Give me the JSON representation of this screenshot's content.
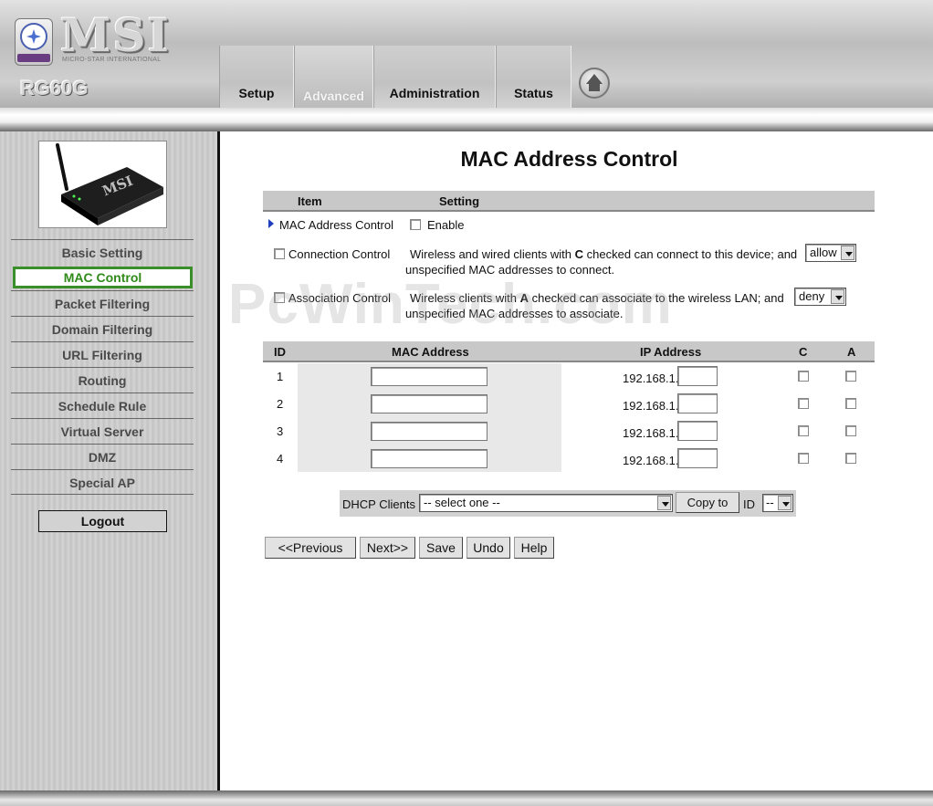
{
  "brand": {
    "logo_text": "MSI",
    "logo_subtitle": "MICRO-STAR INTERNATIONAL",
    "model": "RG60G"
  },
  "nav": {
    "tabs": [
      {
        "label": "Setup",
        "active": false
      },
      {
        "label": "Advanced",
        "active": true
      },
      {
        "label": "Administration",
        "active": false
      },
      {
        "label": "Status",
        "active": false
      }
    ]
  },
  "sidebar": {
    "items": [
      {
        "label": "Basic Setting",
        "active": false
      },
      {
        "label": "MAC Control",
        "active": true
      },
      {
        "label": "Packet Filtering",
        "active": false
      },
      {
        "label": "Domain Filtering",
        "active": false
      },
      {
        "label": "URL Filtering",
        "active": false
      },
      {
        "label": "Routing",
        "active": false
      },
      {
        "label": "Schedule Rule",
        "active": false
      },
      {
        "label": "Virtual Server",
        "active": false
      },
      {
        "label": "DMZ",
        "active": false
      },
      {
        "label": "Special AP",
        "active": false
      }
    ],
    "logout_label": "Logout"
  },
  "main": {
    "title": "MAC Address Control",
    "settings_header": {
      "item": "Item",
      "setting": "Setting"
    },
    "mac_control": {
      "label": "MAC Address Control",
      "enable_label": "Enable",
      "enabled": false
    },
    "connection_control": {
      "label": "Connection Control",
      "text_before": "Wireless and wired clients with ",
      "key_letter": "C",
      "text_after": " checked can connect to this device; and",
      "line2": "unspecified MAC addresses to connect.",
      "select_value": "allow",
      "checked": false
    },
    "association_control": {
      "label": "Association Control",
      "text_before": "Wireless clients with ",
      "key_letter": "A",
      "text_after": " checked can associate to the wireless LAN; and",
      "line2": "unspecified MAC addresses to associate.",
      "select_value": "deny",
      "checked": false
    },
    "table": {
      "headers": {
        "id": "ID",
        "mac": "MAC Address",
        "ip": "IP Address",
        "c": "C",
        "a": "A"
      },
      "ip_prefix": "192.168.1.",
      "rows": [
        {
          "id": "1",
          "mac": "",
          "ip_suffix": "",
          "c": false,
          "a": false
        },
        {
          "id": "2",
          "mac": "",
          "ip_suffix": "",
          "c": false,
          "a": false
        },
        {
          "id": "3",
          "mac": "",
          "ip_suffix": "",
          "c": false,
          "a": false
        },
        {
          "id": "4",
          "mac": "",
          "ip_suffix": "",
          "c": false,
          "a": false
        }
      ]
    },
    "dhcp": {
      "label": "DHCP Clients",
      "select_value": "-- select one --",
      "copy_label": "Copy to",
      "id_label": "ID",
      "id_value": "--"
    },
    "buttons": {
      "previous": "<<Previous",
      "next": "Next>>",
      "save": "Save",
      "undo": "Undo",
      "help": "Help"
    }
  },
  "watermark": "PcWinTech.com",
  "colors": {
    "active_menu_text": "#2f8a1a",
    "active_menu_border": "#3b8f2a",
    "header_gray": "#c8c8c8"
  }
}
